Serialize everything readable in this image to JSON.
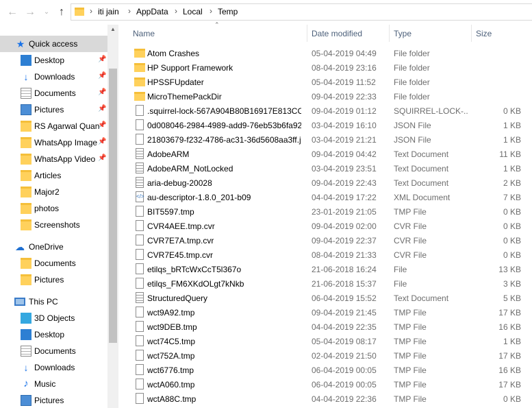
{
  "address": {
    "back_icon": "arrow-left-icon",
    "forward_icon": "arrow-right-icon",
    "recent_icon": "chevron-down-icon",
    "up_icon": "arrow-up-icon",
    "crumbs": [
      "iti jain",
      "AppData",
      "Local",
      "Temp"
    ]
  },
  "sidebar": {
    "quick_access": "Quick access",
    "items": [
      {
        "label": "Desktop",
        "icon": "desktop-icon",
        "pinned": true
      },
      {
        "label": "Downloads",
        "icon": "download-icon",
        "pinned": true
      },
      {
        "label": "Documents",
        "icon": "documents-icon",
        "pinned": true
      },
      {
        "label": "Pictures",
        "icon": "pictures-icon",
        "pinned": true
      },
      {
        "label": "RS Agarwal Quan",
        "icon": "folder-icon",
        "pinned": true
      },
      {
        "label": "WhatsApp Image",
        "icon": "folder-icon",
        "pinned": true
      },
      {
        "label": "WhatsApp Video",
        "icon": "folder-icon",
        "pinned": true
      },
      {
        "label": "Articles",
        "icon": "folder-icon",
        "pinned": false
      },
      {
        "label": "Major2",
        "icon": "folder-icon",
        "pinned": false
      },
      {
        "label": "photos",
        "icon": "folder-icon",
        "pinned": false
      },
      {
        "label": "Screenshots",
        "icon": "folder-icon",
        "pinned": false
      }
    ],
    "onedrive": "OneDrive",
    "onedrive_items": [
      "Documents",
      "Pictures"
    ],
    "thispc": "This PC",
    "thispc_items": [
      "3D Objects",
      "Desktop",
      "Documents",
      "Downloads",
      "Music",
      "Pictures"
    ]
  },
  "columns": {
    "name": "Name",
    "date": "Date modified",
    "type": "Type",
    "size": "Size"
  },
  "files": [
    {
      "name": "Atom Crashes",
      "date": "05-04-2019 04:49",
      "type": "File folder",
      "size": "",
      "icon": "folder"
    },
    {
      "name": "HP Support Framework",
      "date": "08-04-2019 23:16",
      "type": "File folder",
      "size": "",
      "icon": "folder"
    },
    {
      "name": "HPSSFUpdater",
      "date": "05-04-2019 11:52",
      "type": "File folder",
      "size": "",
      "icon": "folder"
    },
    {
      "name": "MicroThemePackDir",
      "date": "09-04-2019 22:33",
      "type": "File folder",
      "size": "",
      "icon": "folder"
    },
    {
      "name": ".squirrel-lock-567A904B80B16917E813CC...",
      "date": "09-04-2019 01:12",
      "type": "SQUIRREL-LOCK-...",
      "size": "0 KB",
      "icon": "file"
    },
    {
      "name": "0d008046-2984-4989-add9-76eb53b6fa92...",
      "date": "03-04-2019 16:10",
      "type": "JSON File",
      "size": "1 KB",
      "icon": "file"
    },
    {
      "name": "21803679-f232-4786-ac31-36d5608aa3ff.j...",
      "date": "03-04-2019 21:21",
      "type": "JSON File",
      "size": "1 KB",
      "icon": "file"
    },
    {
      "name": "AdobeARM",
      "date": "09-04-2019 04:42",
      "type": "Text Document",
      "size": "11 KB",
      "icon": "text"
    },
    {
      "name": "AdobeARM_NotLocked",
      "date": "03-04-2019 23:51",
      "type": "Text Document",
      "size": "1 KB",
      "icon": "text"
    },
    {
      "name": "aria-debug-20028",
      "date": "09-04-2019 22:43",
      "type": "Text Document",
      "size": "2 KB",
      "icon": "text"
    },
    {
      "name": "au-descriptor-1.8.0_201-b09",
      "date": "04-04-2019 17:22",
      "type": "XML Document",
      "size": "7 KB",
      "icon": "xml"
    },
    {
      "name": "BIT5597.tmp",
      "date": "23-01-2019 21:05",
      "type": "TMP File",
      "size": "0 KB",
      "icon": "file"
    },
    {
      "name": "CVR4AEE.tmp.cvr",
      "date": "09-04-2019 02:00",
      "type": "CVR File",
      "size": "0 KB",
      "icon": "file"
    },
    {
      "name": "CVR7E7A.tmp.cvr",
      "date": "09-04-2019 22:37",
      "type": "CVR File",
      "size": "0 KB",
      "icon": "file"
    },
    {
      "name": "CVR7E45.tmp.cvr",
      "date": "08-04-2019 21:33",
      "type": "CVR File",
      "size": "0 KB",
      "icon": "file"
    },
    {
      "name": "etilqs_bRTcWxCcT5l367o",
      "date": "21-06-2018 16:24",
      "type": "File",
      "size": "13 KB",
      "icon": "file"
    },
    {
      "name": "etilqs_FM6XKdOLgt7kNkb",
      "date": "21-06-2018 15:37",
      "type": "File",
      "size": "3 KB",
      "icon": "file"
    },
    {
      "name": "StructuredQuery",
      "date": "06-04-2019 15:52",
      "type": "Text Document",
      "size": "5 KB",
      "icon": "text"
    },
    {
      "name": "wct9A92.tmp",
      "date": "09-04-2019 21:45",
      "type": "TMP File",
      "size": "17 KB",
      "icon": "file"
    },
    {
      "name": "wct9DEB.tmp",
      "date": "04-04-2019 22:35",
      "type": "TMP File",
      "size": "16 KB",
      "icon": "file"
    },
    {
      "name": "wct74C5.tmp",
      "date": "05-04-2019 08:17",
      "type": "TMP File",
      "size": "1 KB",
      "icon": "file"
    },
    {
      "name": "wct752A.tmp",
      "date": "02-04-2019 21:50",
      "type": "TMP File",
      "size": "17 KB",
      "icon": "file"
    },
    {
      "name": "wct6776.tmp",
      "date": "06-04-2019 00:05",
      "type": "TMP File",
      "size": "16 KB",
      "icon": "file"
    },
    {
      "name": "wctA060.tmp",
      "date": "06-04-2019 00:05",
      "type": "TMP File",
      "size": "17 KB",
      "icon": "file"
    },
    {
      "name": "wctA88C.tmp",
      "date": "04-04-2019 22:36",
      "type": "TMP File",
      "size": "0 KB",
      "icon": "file"
    }
  ],
  "colors": {
    "header_text": "#4c607a",
    "secondary_text": "#6d6d6d",
    "selected_nav": "#d9d9d9",
    "folder": "#ffd15c"
  }
}
